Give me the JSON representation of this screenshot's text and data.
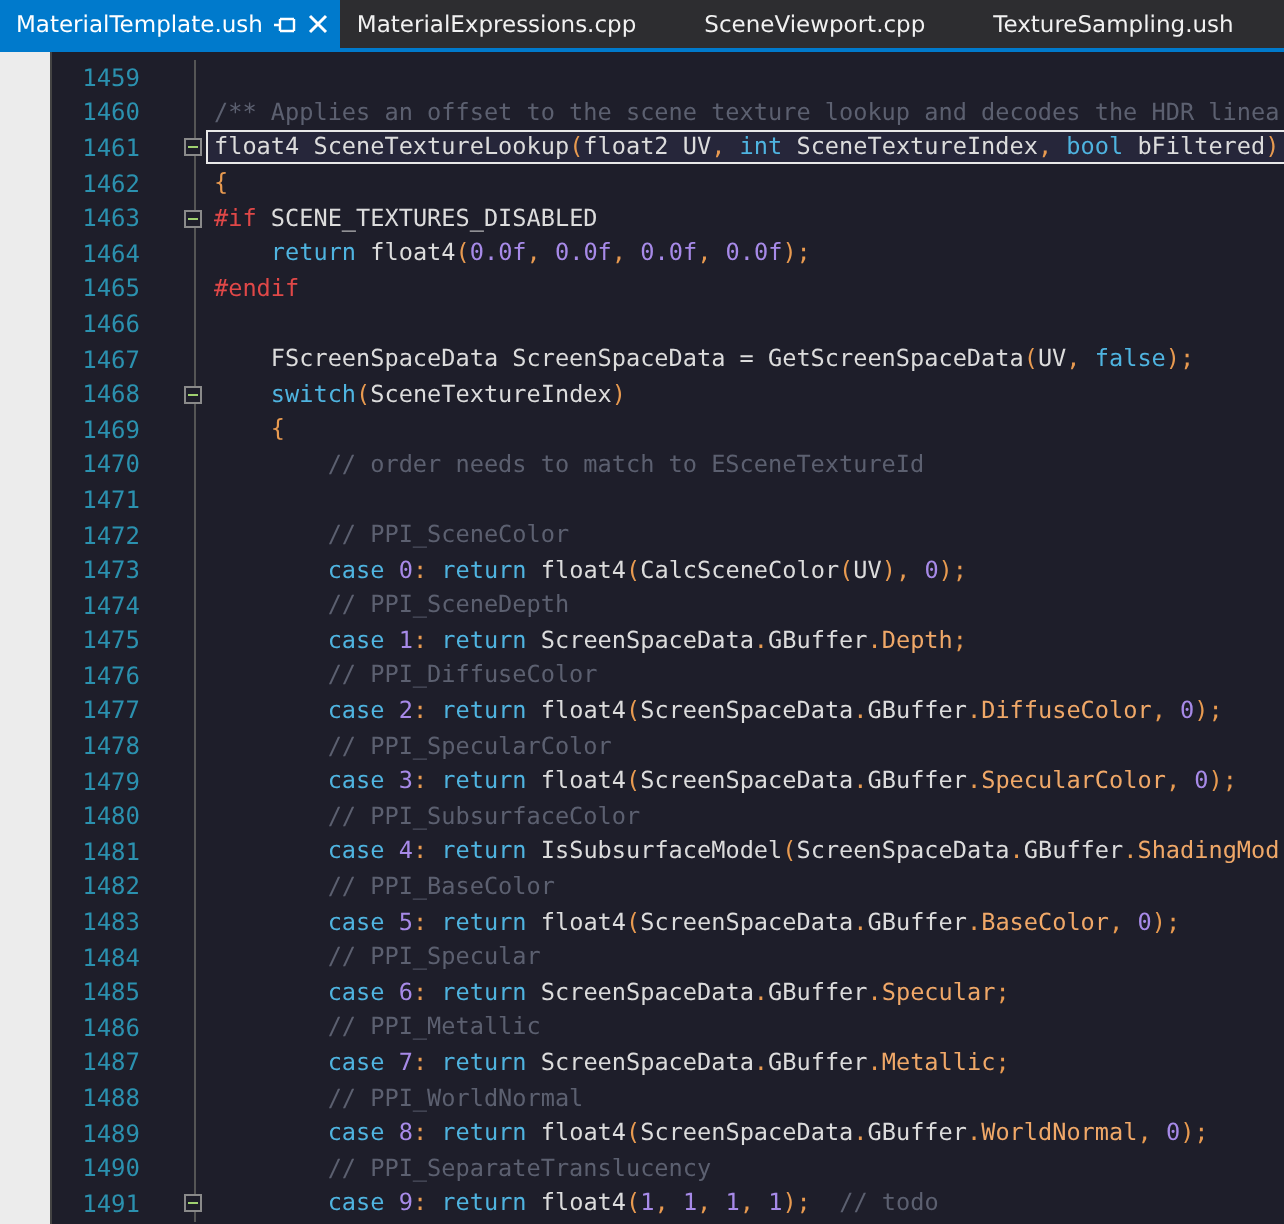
{
  "tabs": [
    {
      "label": "MaterialTemplate.ush",
      "selected": true,
      "pinned": true
    },
    {
      "label": "MaterialExpressions.cpp",
      "selected": false
    },
    {
      "label": "SceneViewport.cpp",
      "selected": false
    },
    {
      "label": "TextureSampling.ush",
      "selected": false
    }
  ],
  "editor": {
    "lines": [
      {
        "number": "1459"
      },
      {
        "number": "1460",
        "tokens": [
          {
            "kind": "cm",
            "text": "/** Applies an offset to the scene texture lookup and decodes the HDR linea"
          }
        ]
      },
      {
        "number": "1461",
        "fold": {
          "expanded": true
        },
        "current": true,
        "tokens": [
          {
            "kind": "pl",
            "text": "float4 SceneTextureLookup"
          },
          {
            "kind": "pu",
            "text": "("
          },
          {
            "kind": "pl",
            "text": "float2 UV"
          },
          {
            "kind": "pu",
            "text": ","
          },
          {
            "kind": "kw",
            "text": " int"
          },
          {
            "kind": "pl",
            "text": " SceneTextureIndex"
          },
          {
            "kind": "pu",
            "text": ","
          },
          {
            "kind": "kw",
            "text": " bool"
          },
          {
            "kind": "pl",
            "text": " bFiltered"
          },
          {
            "kind": "pu",
            "text": ")"
          }
        ]
      },
      {
        "number": "1462",
        "tokens": [
          {
            "kind": "pu",
            "text": "{"
          }
        ]
      },
      {
        "number": "1463",
        "fold": {
          "expanded": true
        },
        "tokens": [
          {
            "kind": "pp",
            "text": "#if"
          },
          {
            "kind": "pl",
            "text": " SCENE_TEXTURES_DISABLED"
          }
        ]
      },
      {
        "number": "1464",
        "tokens": [
          {
            "kind": "kw",
            "text": "    return"
          },
          {
            "kind": "pl",
            "text": " float4"
          },
          {
            "kind": "pu",
            "text": "("
          },
          {
            "kind": "num",
            "text": "0.0f"
          },
          {
            "kind": "pu",
            "text": ", "
          },
          {
            "kind": "num",
            "text": "0.0f"
          },
          {
            "kind": "pu",
            "text": ", "
          },
          {
            "kind": "num",
            "text": "0.0f"
          },
          {
            "kind": "pu",
            "text": ", "
          },
          {
            "kind": "num",
            "text": "0.0f"
          },
          {
            "kind": "pu",
            "text": ");"
          }
        ]
      },
      {
        "number": "1465",
        "tokens": [
          {
            "kind": "pp",
            "text": "#endif"
          }
        ]
      },
      {
        "number": "1466"
      },
      {
        "number": "1467",
        "tokens": [
          {
            "kind": "pl",
            "text": "    FScreenSpaceData ScreenSpaceData = GetScreenSpaceData"
          },
          {
            "kind": "pu",
            "text": "("
          },
          {
            "kind": "pl",
            "text": "UV"
          },
          {
            "kind": "pu",
            "text": ", "
          },
          {
            "kind": "kw",
            "text": "false"
          },
          {
            "kind": "pu",
            "text": ");"
          }
        ]
      },
      {
        "number": "1468",
        "fold": {
          "expanded": true
        },
        "tokens": [
          {
            "kind": "kw",
            "text": "    switch"
          },
          {
            "kind": "pu",
            "text": "("
          },
          {
            "kind": "pl",
            "text": "SceneTextureIndex"
          },
          {
            "kind": "pu",
            "text": ")"
          }
        ]
      },
      {
        "number": "1469",
        "tokens": [
          {
            "kind": "pu",
            "text": "    {"
          }
        ]
      },
      {
        "number": "1470",
        "tokens": [
          {
            "kind": "cm",
            "text": "        // order needs to match to ESceneTextureId"
          }
        ]
      },
      {
        "number": "1471"
      },
      {
        "number": "1472",
        "tokens": [
          {
            "kind": "cm",
            "text": "        // PPI_SceneColor"
          }
        ]
      },
      {
        "number": "1473",
        "tokens": [
          {
            "kind": "kw",
            "text": "        case "
          },
          {
            "kind": "num",
            "text": "0"
          },
          {
            "kind": "pu",
            "text": ":"
          },
          {
            "kind": "kw",
            "text": " return"
          },
          {
            "kind": "pl",
            "text": " float4"
          },
          {
            "kind": "pu",
            "text": "("
          },
          {
            "kind": "pl",
            "text": "CalcSceneColor"
          },
          {
            "kind": "pu",
            "text": "("
          },
          {
            "kind": "pl",
            "text": "UV"
          },
          {
            "kind": "pu",
            "text": "), "
          },
          {
            "kind": "num",
            "text": "0"
          },
          {
            "kind": "pu",
            "text": ");"
          }
        ]
      },
      {
        "number": "1474",
        "tokens": [
          {
            "kind": "cm",
            "text": "        // PPI_SceneDepth"
          }
        ]
      },
      {
        "number": "1475",
        "tokens": [
          {
            "kind": "kw",
            "text": "        case "
          },
          {
            "kind": "num",
            "text": "1"
          },
          {
            "kind": "pu",
            "text": ":"
          },
          {
            "kind": "kw",
            "text": " return"
          },
          {
            "kind": "pl",
            "text": " ScreenSpaceData"
          },
          {
            "kind": "pu",
            "text": "."
          },
          {
            "kind": "pl",
            "text": "GBuffer"
          },
          {
            "kind": "pu",
            "text": "."
          },
          {
            "kind": "mem",
            "text": "Depth"
          },
          {
            "kind": "pu",
            "text": ";"
          }
        ]
      },
      {
        "number": "1476",
        "tokens": [
          {
            "kind": "cm",
            "text": "        // PPI_DiffuseColor"
          }
        ]
      },
      {
        "number": "1477",
        "tokens": [
          {
            "kind": "kw",
            "text": "        case "
          },
          {
            "kind": "num",
            "text": "2"
          },
          {
            "kind": "pu",
            "text": ":"
          },
          {
            "kind": "kw",
            "text": " return"
          },
          {
            "kind": "pl",
            "text": " float4"
          },
          {
            "kind": "pu",
            "text": "("
          },
          {
            "kind": "pl",
            "text": "ScreenSpaceData"
          },
          {
            "kind": "pu",
            "text": "."
          },
          {
            "kind": "pl",
            "text": "GBuffer"
          },
          {
            "kind": "pu",
            "text": "."
          },
          {
            "kind": "mem",
            "text": "DiffuseColor"
          },
          {
            "kind": "pu",
            "text": ", "
          },
          {
            "kind": "num",
            "text": "0"
          },
          {
            "kind": "pu",
            "text": ");"
          }
        ]
      },
      {
        "number": "1478",
        "tokens": [
          {
            "kind": "cm",
            "text": "        // PPI_SpecularColor"
          }
        ]
      },
      {
        "number": "1479",
        "tokens": [
          {
            "kind": "kw",
            "text": "        case "
          },
          {
            "kind": "num",
            "text": "3"
          },
          {
            "kind": "pu",
            "text": ":"
          },
          {
            "kind": "kw",
            "text": " return"
          },
          {
            "kind": "pl",
            "text": " float4"
          },
          {
            "kind": "pu",
            "text": "("
          },
          {
            "kind": "pl",
            "text": "ScreenSpaceData"
          },
          {
            "kind": "pu",
            "text": "."
          },
          {
            "kind": "pl",
            "text": "GBuffer"
          },
          {
            "kind": "pu",
            "text": "."
          },
          {
            "kind": "mem",
            "text": "SpecularColor"
          },
          {
            "kind": "pu",
            "text": ", "
          },
          {
            "kind": "num",
            "text": "0"
          },
          {
            "kind": "pu",
            "text": ");"
          }
        ]
      },
      {
        "number": "1480",
        "tokens": [
          {
            "kind": "cm",
            "text": "        // PPI_SubsurfaceColor"
          }
        ]
      },
      {
        "number": "1481",
        "tokens": [
          {
            "kind": "kw",
            "text": "        case "
          },
          {
            "kind": "num",
            "text": "4"
          },
          {
            "kind": "pu",
            "text": ":"
          },
          {
            "kind": "kw",
            "text": " return"
          },
          {
            "kind": "pl",
            "text": " IsSubsurfaceModel"
          },
          {
            "kind": "pu",
            "text": "("
          },
          {
            "kind": "pl",
            "text": "ScreenSpaceData"
          },
          {
            "kind": "pu",
            "text": "."
          },
          {
            "kind": "pl",
            "text": "GBuffer"
          },
          {
            "kind": "pu",
            "text": "."
          },
          {
            "kind": "mem",
            "text": "ShadingMod"
          }
        ]
      },
      {
        "number": "1482",
        "tokens": [
          {
            "kind": "cm",
            "text": "        // PPI_BaseColor"
          }
        ]
      },
      {
        "number": "1483",
        "tokens": [
          {
            "kind": "kw",
            "text": "        case "
          },
          {
            "kind": "num",
            "text": "5"
          },
          {
            "kind": "pu",
            "text": ":"
          },
          {
            "kind": "kw",
            "text": " return"
          },
          {
            "kind": "pl",
            "text": " float4"
          },
          {
            "kind": "pu",
            "text": "("
          },
          {
            "kind": "pl",
            "text": "ScreenSpaceData"
          },
          {
            "kind": "pu",
            "text": "."
          },
          {
            "kind": "pl",
            "text": "GBuffer"
          },
          {
            "kind": "pu",
            "text": "."
          },
          {
            "kind": "mem",
            "text": "BaseColor"
          },
          {
            "kind": "pu",
            "text": ", "
          },
          {
            "kind": "num",
            "text": "0"
          },
          {
            "kind": "pu",
            "text": ");"
          }
        ]
      },
      {
        "number": "1484",
        "tokens": [
          {
            "kind": "cm",
            "text": "        // PPI_Specular"
          }
        ]
      },
      {
        "number": "1485",
        "tokens": [
          {
            "kind": "kw",
            "text": "        case "
          },
          {
            "kind": "num",
            "text": "6"
          },
          {
            "kind": "pu",
            "text": ":"
          },
          {
            "kind": "kw",
            "text": " return"
          },
          {
            "kind": "pl",
            "text": " ScreenSpaceData"
          },
          {
            "kind": "pu",
            "text": "."
          },
          {
            "kind": "pl",
            "text": "GBuffer"
          },
          {
            "kind": "pu",
            "text": "."
          },
          {
            "kind": "mem",
            "text": "Specular"
          },
          {
            "kind": "pu",
            "text": ";"
          }
        ]
      },
      {
        "number": "1486",
        "tokens": [
          {
            "kind": "cm",
            "text": "        // PPI_Metallic"
          }
        ]
      },
      {
        "number": "1487",
        "tokens": [
          {
            "kind": "kw",
            "text": "        case "
          },
          {
            "kind": "num",
            "text": "7"
          },
          {
            "kind": "pu",
            "text": ":"
          },
          {
            "kind": "kw",
            "text": " return"
          },
          {
            "kind": "pl",
            "text": " ScreenSpaceData"
          },
          {
            "kind": "pu",
            "text": "."
          },
          {
            "kind": "pl",
            "text": "GBuffer"
          },
          {
            "kind": "pu",
            "text": "."
          },
          {
            "kind": "mem",
            "text": "Metallic"
          },
          {
            "kind": "pu",
            "text": ";"
          }
        ]
      },
      {
        "number": "1488",
        "tokens": [
          {
            "kind": "cm",
            "text": "        // PPI_WorldNormal"
          }
        ]
      },
      {
        "number": "1489",
        "tokens": [
          {
            "kind": "kw",
            "text": "        case "
          },
          {
            "kind": "num",
            "text": "8"
          },
          {
            "kind": "pu",
            "text": ":"
          },
          {
            "kind": "kw",
            "text": " return"
          },
          {
            "kind": "pl",
            "text": " float4"
          },
          {
            "kind": "pu",
            "text": "("
          },
          {
            "kind": "pl",
            "text": "ScreenSpaceData"
          },
          {
            "kind": "pu",
            "text": "."
          },
          {
            "kind": "pl",
            "text": "GBuffer"
          },
          {
            "kind": "pu",
            "text": "."
          },
          {
            "kind": "mem",
            "text": "WorldNormal"
          },
          {
            "kind": "pu",
            "text": ", "
          },
          {
            "kind": "num",
            "text": "0"
          },
          {
            "kind": "pu",
            "text": ");"
          }
        ]
      },
      {
        "number": "1490",
        "tokens": [
          {
            "kind": "cm",
            "text": "        // PPI_SeparateTranslucency"
          }
        ]
      },
      {
        "number": "1491",
        "fold": {
          "expanded": true
        },
        "tokens": [
          {
            "kind": "kw",
            "text": "        case "
          },
          {
            "kind": "num",
            "text": "9"
          },
          {
            "kind": "pu",
            "text": ":"
          },
          {
            "kind": "kw",
            "text": " return"
          },
          {
            "kind": "pl",
            "text": " float4"
          },
          {
            "kind": "pu",
            "text": "("
          },
          {
            "kind": "num",
            "text": "1"
          },
          {
            "kind": "pu",
            "text": ", "
          },
          {
            "kind": "num",
            "text": "1"
          },
          {
            "kind": "pu",
            "text": ", "
          },
          {
            "kind": "num",
            "text": "1"
          },
          {
            "kind": "pu",
            "text": ", "
          },
          {
            "kind": "num",
            "text": "1"
          },
          {
            "kind": "pu",
            "text": ");"
          },
          {
            "kind": "cm",
            "text": "  // todo"
          }
        ]
      }
    ]
  }
}
